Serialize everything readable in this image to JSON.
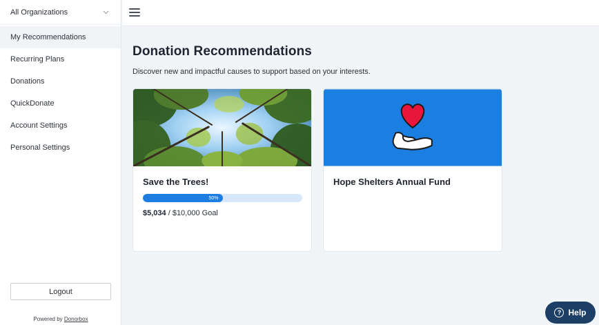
{
  "sidebar": {
    "org_selector": "All Organizations",
    "items": [
      {
        "label": "My Recommendations",
        "active": true
      },
      {
        "label": "Recurring Plans"
      },
      {
        "label": "Donations"
      },
      {
        "label": "QuickDonate"
      },
      {
        "label": "Account Settings"
      },
      {
        "label": "Personal Settings"
      }
    ],
    "logout_label": "Logout",
    "powered_by": "Powered by",
    "powered_link": "Donorbox"
  },
  "main": {
    "title": "Donation Recommendations",
    "subtitle": "Discover new and impactful causes to support based on your interests."
  },
  "cards": [
    {
      "title": "Save the Trees!",
      "progress_percent": 50,
      "progress_label": "50%",
      "raised": "$5,034",
      "goal": " / $10,000 Goal",
      "image": "forest-canopy-photo"
    },
    {
      "title": "Hope Shelters Annual Fund",
      "image": "heart-in-hand-icon",
      "image_bg": "#1a7fe0"
    }
  ],
  "help_label": "Help",
  "colors": {
    "accent": "#1d7de0",
    "help_button": "#1d3f66",
    "progress_track": "#d9e7fb",
    "heart": "#e8173a"
  }
}
